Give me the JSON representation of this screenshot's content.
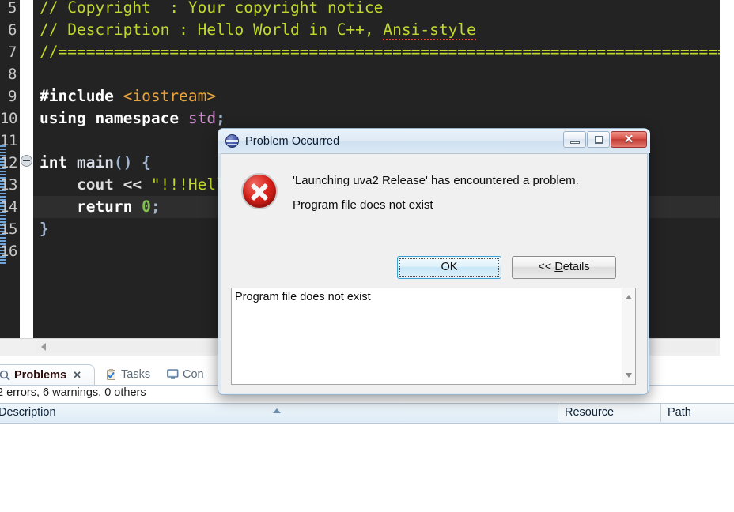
{
  "editor": {
    "name": "cpp-source-editor",
    "lines": [
      {
        "num": "5",
        "segments": [
          {
            "t": "// Copyright  : Your copyright notice",
            "c": "c-comment-b"
          }
        ]
      },
      {
        "num": "6",
        "segments": [
          {
            "t": "// Description : Hello World in C++, ",
            "c": "c-comment-b"
          },
          {
            "t": "Ansi-style",
            "c": "c-comment-b squig"
          }
        ]
      },
      {
        "num": "7",
        "segments": [
          {
            "t": "//============================================================================",
            "c": "c-comment-b"
          }
        ]
      },
      {
        "num": "8",
        "segments": [
          {
            "t": "",
            "c": "c-plain"
          }
        ]
      },
      {
        "num": "9",
        "segments": [
          {
            "t": "#include ",
            "c": "c-kw"
          },
          {
            "t": "<iostream>",
            "c": "c-inc"
          }
        ]
      },
      {
        "num": "10",
        "segments": [
          {
            "t": "using namespace ",
            "c": "c-kw"
          },
          {
            "t": "std",
            "c": "c-type"
          },
          {
            "t": ";",
            "c": "c-punct"
          }
        ]
      },
      {
        "num": "11",
        "segments": [
          {
            "t": "",
            "c": "c-plain"
          }
        ]
      },
      {
        "num": "12",
        "segments": [
          {
            "t": "int ",
            "c": "c-kw"
          },
          {
            "t": "main",
            "c": "c-ident"
          },
          {
            "t": "() {",
            "c": "c-punct"
          }
        ]
      },
      {
        "num": "13",
        "segments": [
          {
            "t": "    cout << ",
            "c": "c-plain"
          },
          {
            "t": "\"!!!Hello",
            "c": "c-str"
          }
        ]
      },
      {
        "num": "14",
        "segments": [
          {
            "t": "    return ",
            "c": "c-kw"
          },
          {
            "t": "0",
            "c": "c-num"
          },
          {
            "t": ";",
            "c": "c-punct"
          }
        ]
      },
      {
        "num": "15",
        "segments": [
          {
            "t": "}",
            "c": "c-punct"
          }
        ]
      },
      {
        "num": "16",
        "segments": [
          {
            "t": "",
            "c": "c-plain"
          }
        ]
      }
    ],
    "current_line_index": 9,
    "fold_marker_line_index": 7,
    "colors": {
      "background": "#232323",
      "comment": "#c3d82c",
      "keyword": "#ffffff",
      "string": "#c3d82c",
      "include": "#e8a33d",
      "number": "#7fbf4f",
      "line_number": "#c9c9c9",
      "current_line_highlight": "#2e2e2e"
    }
  },
  "dialog": {
    "title": "Problem Occurred",
    "title_icon": "eclipse-icon",
    "error_icon": "error-circle-icon",
    "message_line1": "'Launching uva2 Release' has encountered a problem.",
    "message_line2": "Program file does not exist",
    "ok_label": "OK",
    "details_label_prefix": "<< ",
    "details_label_accel": "D",
    "details_label_rest": "etails",
    "details_text": "Program file does not exist",
    "window_buttons": {
      "minimize": "minimize-icon",
      "maximize": "maximize-icon",
      "close": "✕"
    }
  },
  "bottom_panel": {
    "tabs": [
      {
        "label": "Problems",
        "icon": "problems-icon",
        "active": true,
        "close": "✕"
      },
      {
        "label": "Tasks",
        "icon": "tasks-icon",
        "active": false
      },
      {
        "label": "Con",
        "icon": "console-icon",
        "active": false
      }
    ],
    "summary": "2 errors, 6 warnings, 0 others",
    "columns": [
      {
        "label": "Description"
      },
      {
        "label": "Resource"
      },
      {
        "label": "Path"
      }
    ]
  }
}
